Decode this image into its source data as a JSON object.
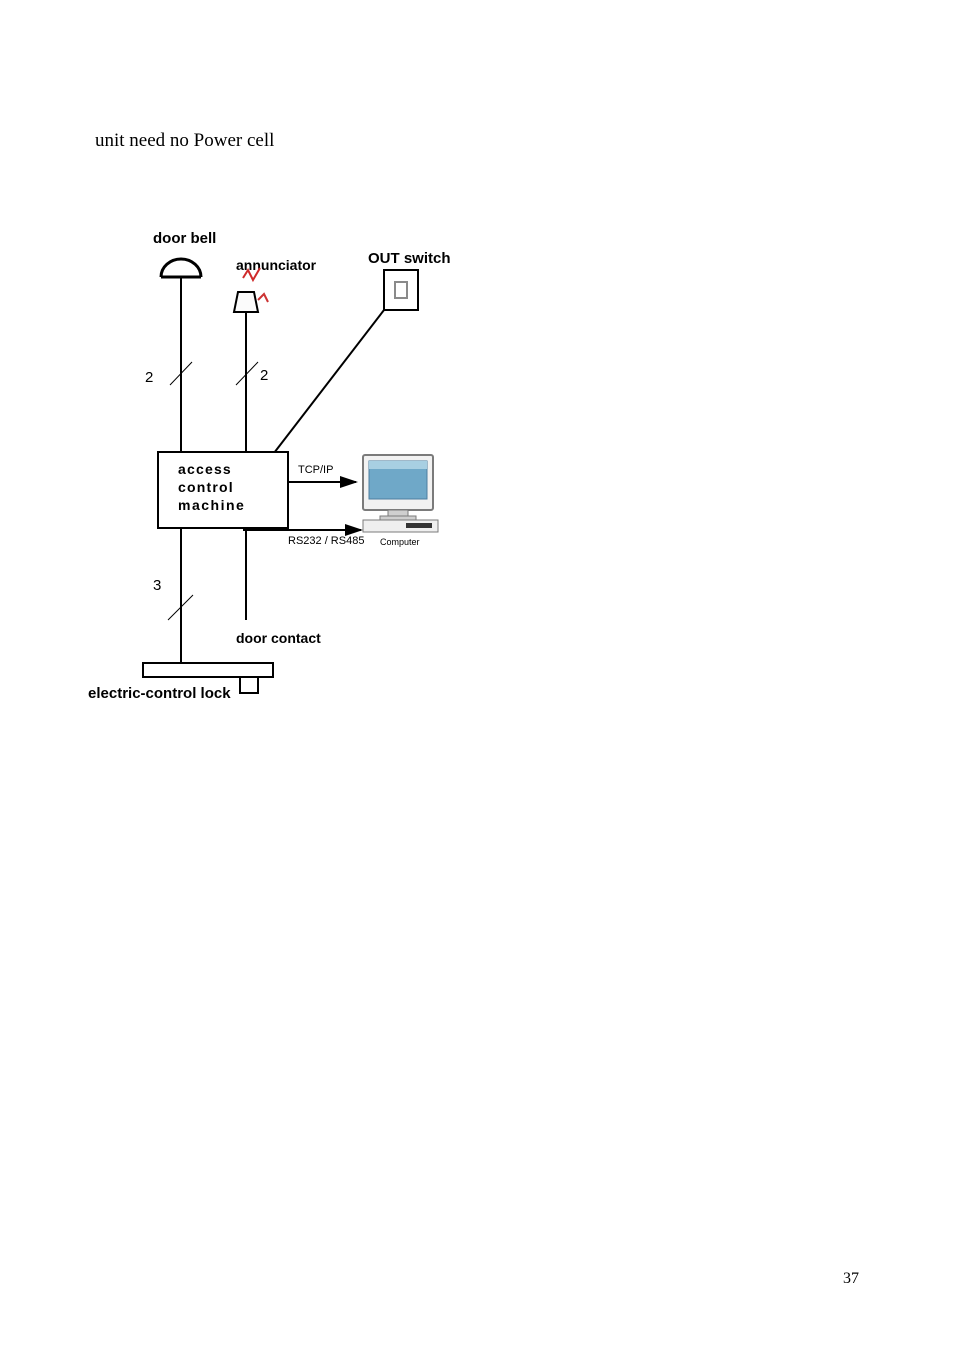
{
  "body_text": "unit need no Power cell",
  "page_number": "37",
  "diagram": {
    "labels": {
      "door_bell": "door bell",
      "annunciator": "annunciator",
      "out_switch": "OUT switch",
      "access_control_1": "access",
      "access_control_2": "control",
      "access_control_3": "machine",
      "tcp_ip": "TCP/IP",
      "rs": "RS232 / RS485",
      "computer": "Computer",
      "two_a": "2",
      "two_b": "2",
      "three": "3",
      "door_contact": "door contact",
      "electric_lock_a": "electric-control lock"
    }
  }
}
